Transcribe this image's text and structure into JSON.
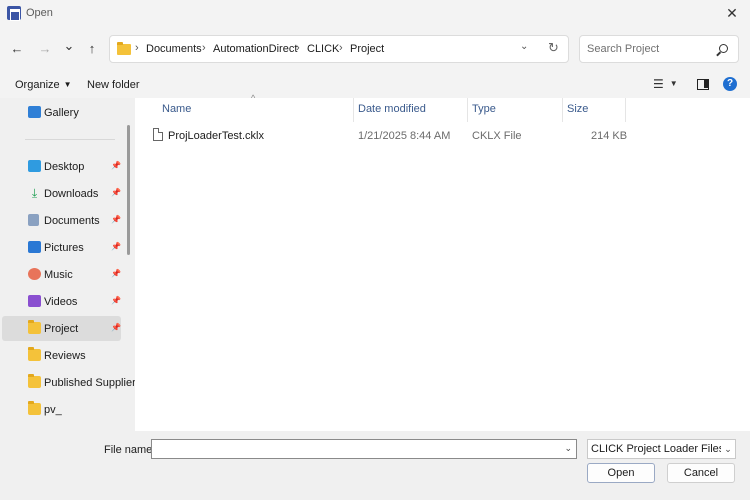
{
  "window": {
    "title": "Open",
    "close_glyph": "✕"
  },
  "nav": {
    "back_glyph": "←",
    "forward_glyph": "→",
    "recent_glyph": "⌄",
    "up_glyph": "↑",
    "breadcrumbs": [
      "Documents",
      "AutomationDirect",
      "CLICK",
      "Project"
    ],
    "separator": "›",
    "dropdown_glyph": "⌄",
    "refresh_glyph": "↻",
    "search_placeholder": "Search Project"
  },
  "toolbar": {
    "organize": "Organize",
    "organize_caret": "▼",
    "new_folder": "New folder",
    "views_glyph": "☰",
    "views_caret": "▼",
    "help_glyph": "?"
  },
  "sidebar": {
    "gallery": "Gallery",
    "items": [
      {
        "label": "Desktop",
        "icon": "desktop-icon",
        "pinned": true
      },
      {
        "label": "Downloads",
        "icon": "download-icon",
        "pinned": true
      },
      {
        "label": "Documents",
        "icon": "documents-icon",
        "pinned": true
      },
      {
        "label": "Pictures",
        "icon": "pictures-icon",
        "pinned": true
      },
      {
        "label": "Music",
        "icon": "music-icon",
        "pinned": true
      },
      {
        "label": "Videos",
        "icon": "videos-icon",
        "pinned": true
      },
      {
        "label": "Project",
        "icon": "folder-icon",
        "pinned": true,
        "selected": true
      },
      {
        "label": "Reviews",
        "icon": "folder-icon",
        "pinned": false
      },
      {
        "label": "Published Supplier",
        "icon": "folder-icon",
        "pinned": false
      },
      {
        "label": "pv_",
        "icon": "folder-icon",
        "pinned": false
      }
    ],
    "pin_glyph": "📌"
  },
  "columns": {
    "name": "Name",
    "date": "Date modified",
    "type": "Type",
    "size": "Size",
    "sort_glyph": "^"
  },
  "files": [
    {
      "name": "ProjLoaderTest.cklx",
      "date": "1/21/2025 8:44 AM",
      "type": "CKLX File",
      "size": "214 KB"
    }
  ],
  "footer": {
    "file_name_label": "File name:",
    "file_name_value": "",
    "dropdown_glyph": "⌄",
    "filter_value": "CLICK Project Loader Files(*.ckl",
    "open": "Open",
    "cancel": "Cancel"
  }
}
